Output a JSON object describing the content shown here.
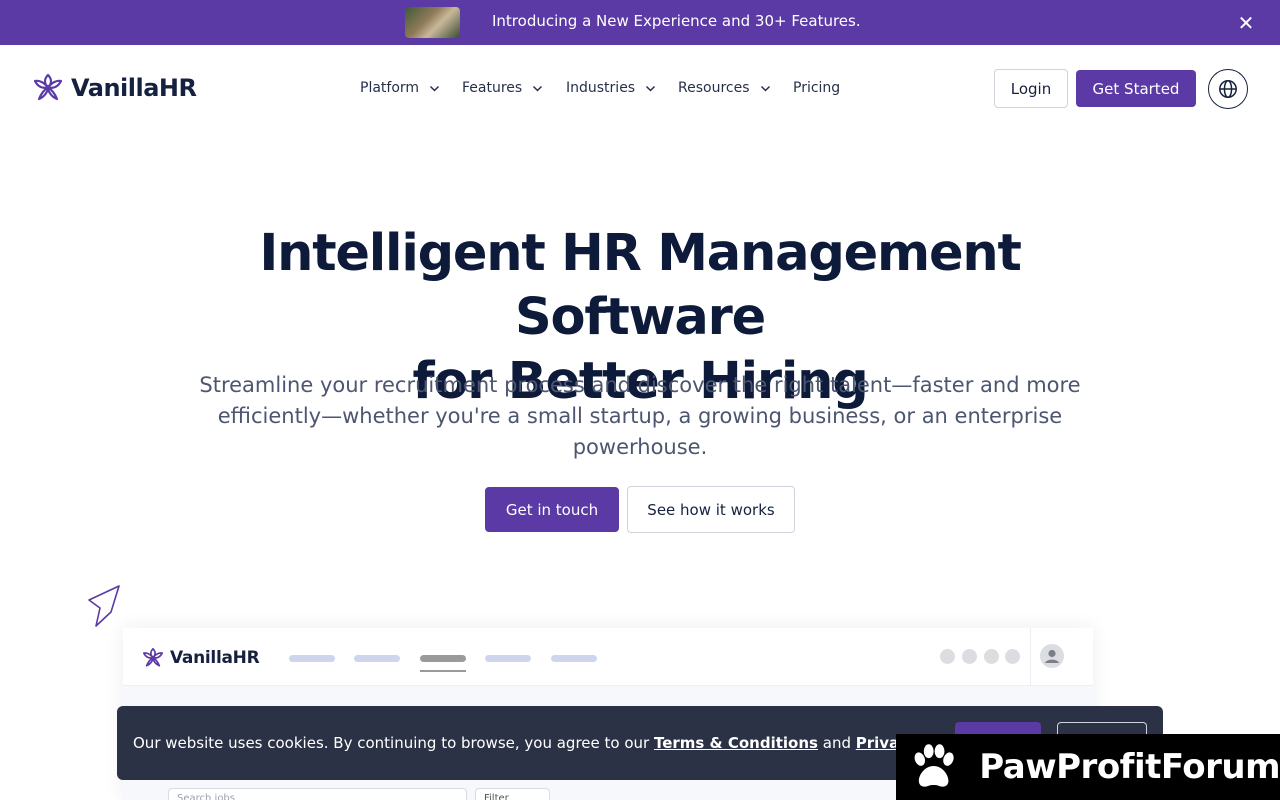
{
  "announcement": {
    "text": "Introducing a New Experience and 30+ Features.",
    "close_icon": "close-icon"
  },
  "nav": {
    "brand": "VanillaHR",
    "items": [
      {
        "label": "Platform",
        "has_dropdown": true
      },
      {
        "label": "Features",
        "has_dropdown": true
      },
      {
        "label": "Industries",
        "has_dropdown": true
      },
      {
        "label": "Resources",
        "has_dropdown": true
      },
      {
        "label": "Pricing",
        "has_dropdown": false
      }
    ],
    "login_label": "Login",
    "get_started_label": "Get Started",
    "language_icon": "globe-icon"
  },
  "hero": {
    "title_line1": "Intelligent HR Management Software",
    "title_line2": "for Better Hiring",
    "subtitle": "Streamline your recruitment process and discover the right talent—faster and more efficiently—whether you're a small startup, a growing business, or an enterprise powerhouse.",
    "primary_cta": "Get in touch",
    "secondary_cta": "See how it works"
  },
  "preview": {
    "brand": "VanillaHR",
    "search_placeholder": "Search jobs",
    "filter_label": "Filter"
  },
  "cookie": {
    "text_prefix": "Our website uses cookies. By continuing to browse, you agree to our",
    "terms_link": "Terms & Conditions",
    "and_word": "and",
    "privacy_link": "Privacy Policy"
  },
  "watermark": {
    "text": "PawProfitForum"
  },
  "colors": {
    "brand_purple": "#5b3aa5",
    "heading": "#0d1a3a",
    "cookie_bg": "#2b3245"
  }
}
